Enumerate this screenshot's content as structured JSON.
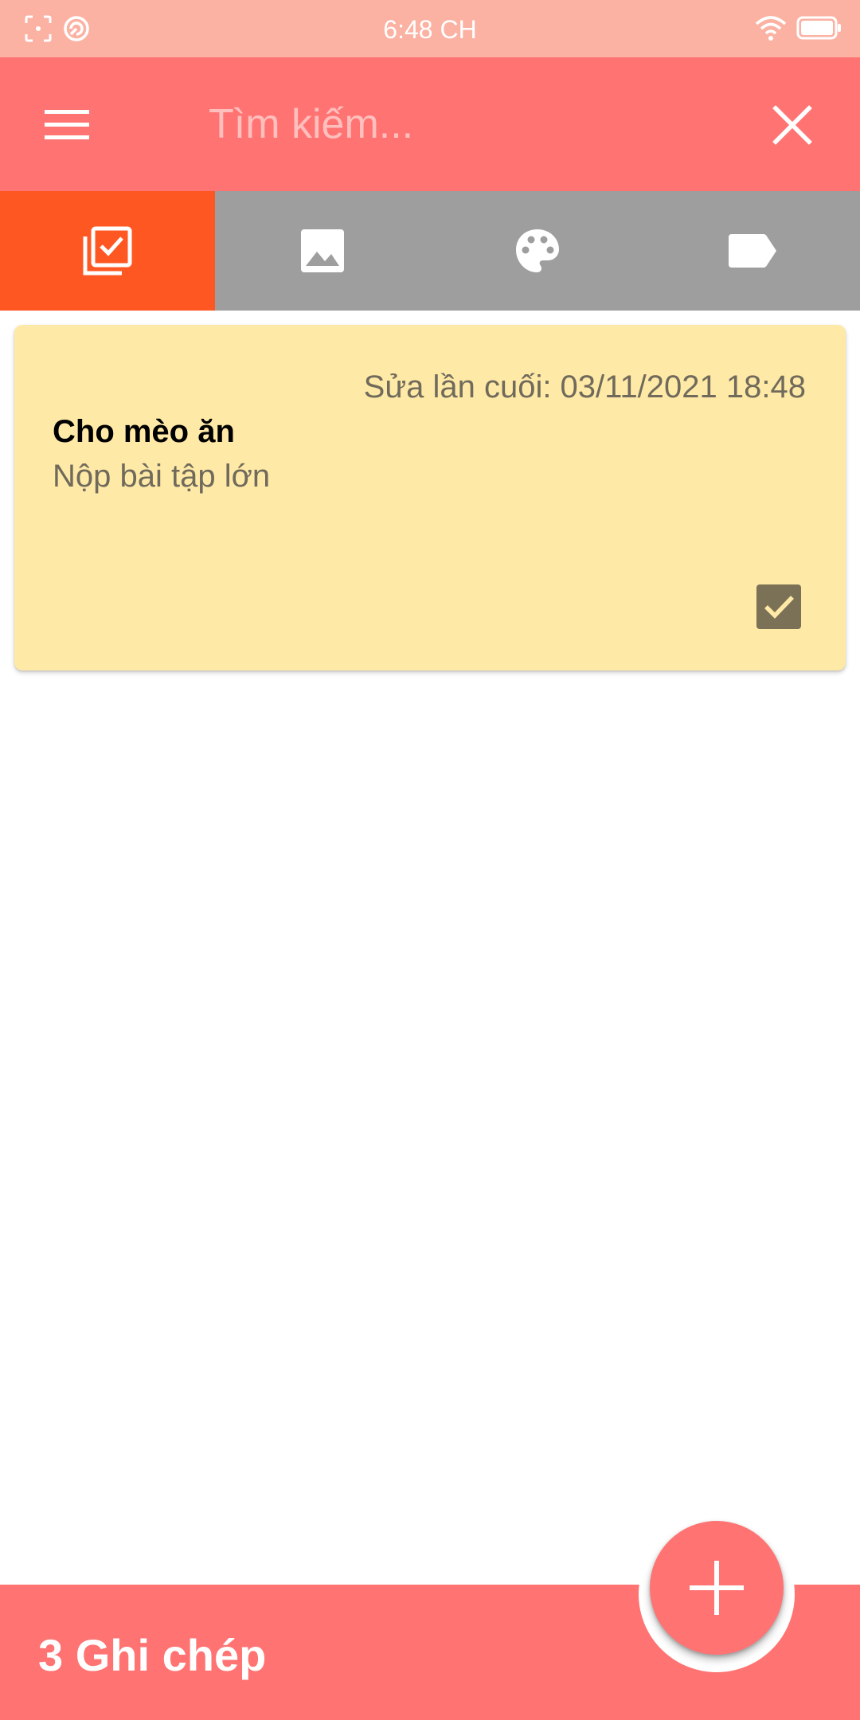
{
  "status_bar": {
    "time": "6:48 CH",
    "left_icons": [
      "screenshot-icon",
      "sync-icon"
    ],
    "right_icons": [
      "wifi-icon",
      "battery-icon"
    ]
  },
  "app_bar": {
    "search_placeholder": "Tìm kiếm...",
    "menu_icon": "menu-icon",
    "close_icon": "close-icon"
  },
  "tabs": [
    {
      "icon": "checklist-icon",
      "active": true
    },
    {
      "icon": "image-icon",
      "active": false
    },
    {
      "icon": "palette-icon",
      "active": false
    },
    {
      "icon": "label-icon",
      "active": false
    }
  ],
  "notes": [
    {
      "last_edited": "Sửa lần cuối: 03/11/2021 18:48",
      "title": "Cho mèo ăn",
      "body": "Nộp bài tập lớn",
      "checked": true
    }
  ],
  "bottom_bar": {
    "count_label": "3 Ghi chép",
    "fab_icon": "add-icon"
  },
  "colors": {
    "primary": "#ff7373",
    "status_bar": "#fbb2a3",
    "active_tab": "#ff5722",
    "inactive_tabs": "#9e9e9e",
    "note_background": "#ffe9a6"
  }
}
